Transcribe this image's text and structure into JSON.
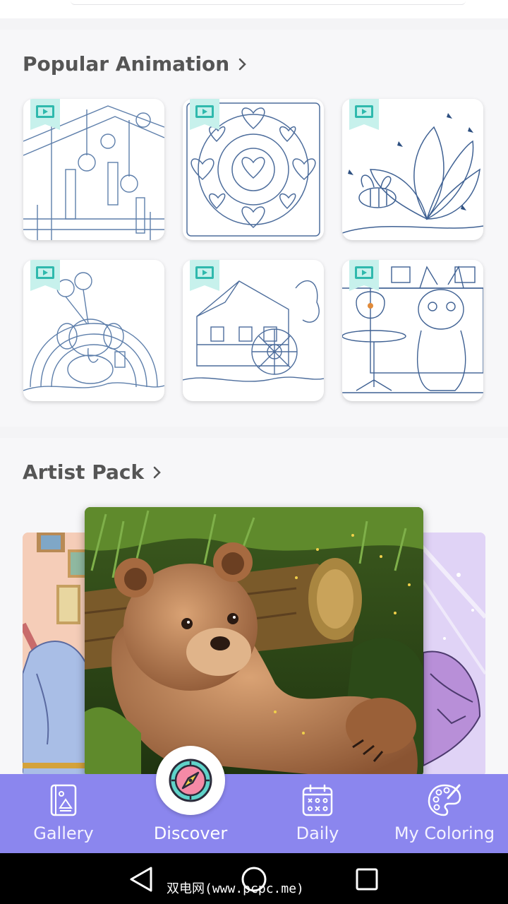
{
  "sections": {
    "popular": {
      "title": "Popular Animation"
    },
    "artist": {
      "title": "Artist Pack"
    }
  },
  "nav": {
    "items": [
      {
        "label": "Gallery",
        "icon": "gallery-icon"
      },
      {
        "label": "Discover",
        "icon": "compass-icon",
        "active": true
      },
      {
        "label": "Daily",
        "icon": "calendar-icon"
      },
      {
        "label": "My Coloring",
        "icon": "palette-icon"
      }
    ]
  },
  "popular_items": [
    {
      "name": "wind-chimes",
      "badge": "AD"
    },
    {
      "name": "heart-mandala",
      "badge": "AD"
    },
    {
      "name": "bee-flower",
      "badge": "AD"
    },
    {
      "name": "elephant-rainbow",
      "badge": "AD"
    },
    {
      "name": "water-mill",
      "badge": "AD"
    },
    {
      "name": "kitten-fishbowl",
      "badge": "AD"
    }
  ],
  "watermark": "双电网(www.pcpc.me)",
  "colors": {
    "accent": "#8b86ee",
    "badge": "#5fd3c9",
    "line_art": "#4b6f9e"
  }
}
